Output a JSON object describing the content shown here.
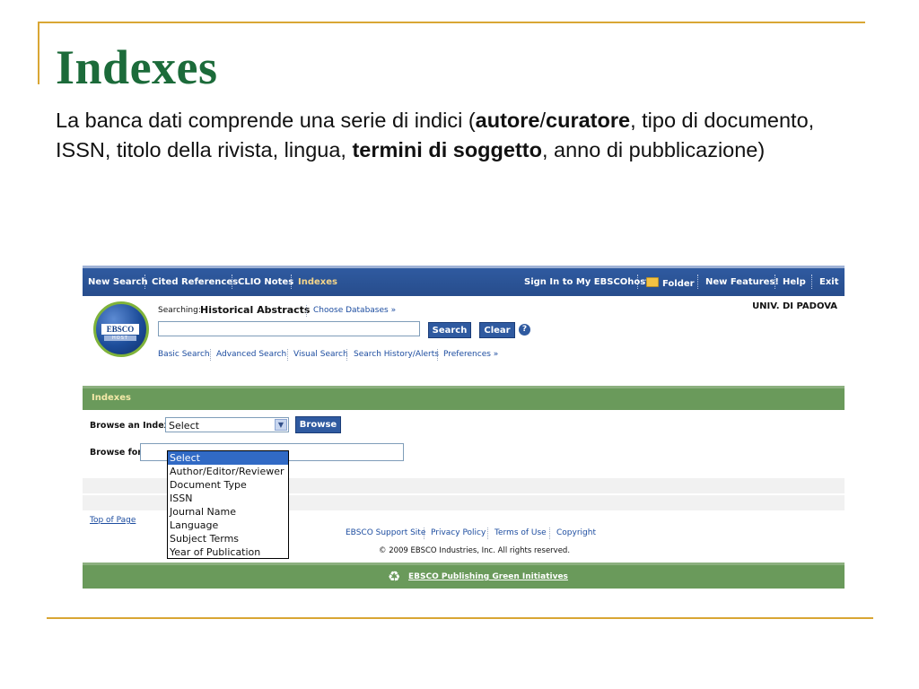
{
  "slide": {
    "title": "Indexes",
    "body": {
      "t1": "La banca dati comprende una serie di indici (",
      "b1": "autore",
      "t2": "/",
      "b2": "curatore",
      "t3": ", tipo di documento, ISSN, titolo della rivista, lingua, ",
      "b3": "termini di soggetto",
      "t4": ", anno di pubblicazione)"
    }
  },
  "app": {
    "topnav": {
      "new_search": "New Search",
      "cited_references": "Cited References",
      "clio_notes": "CLIO Notes",
      "indexes": "Indexes",
      "sign_in": "Sign In to My EBSCOhost",
      "folder": "Folder",
      "new_features": "New Features!",
      "help": "Help",
      "exit": "Exit"
    },
    "logo": {
      "text": "EBSCO",
      "sub": "HOST"
    },
    "institution": "UNIV. DI PADOVA",
    "search": {
      "searching_label": "Searching:",
      "database": "Historical Abstracts",
      "choose_databases": "Choose Databases »",
      "query": "",
      "search_button": "Search",
      "clear_button": "Clear",
      "help_glyph": "?"
    },
    "subnav": {
      "basic": "Basic Search",
      "advanced": "Advanced Search",
      "visual": "Visual Search",
      "history": "Search History/Alerts",
      "preferences": "Preferences »"
    },
    "indexes_panel": {
      "header": "Indexes",
      "browse_index_label": "Browse an Index:",
      "selected_index": "Select",
      "browse_button": "Browse",
      "browse_for_label": "Browse for:",
      "browse_for_value": "",
      "options": [
        "Select",
        "Author/Editor/Reviewer",
        "Document Type",
        "ISSN",
        "Journal Name",
        "Language",
        "Subject Terms",
        "Year of Publication"
      ],
      "highlighted_option": "Select"
    },
    "footer": {
      "top_of_page": "Top of Page",
      "support": "EBSCO Support Site",
      "privacy": "Privacy Policy",
      "terms": "Terms of Use",
      "copyright": "Copyright",
      "copyright_notice": "© 2009 EBSCO Industries, Inc. All rights reserved.",
      "green": "EBSCO Publishing Green Initiatives"
    },
    "colors": {
      "nav_blue": "#2f5aa0",
      "panel_green": "#6a9a5b",
      "title_green": "#1c6b3a",
      "accent_gold": "#d9a634"
    }
  }
}
